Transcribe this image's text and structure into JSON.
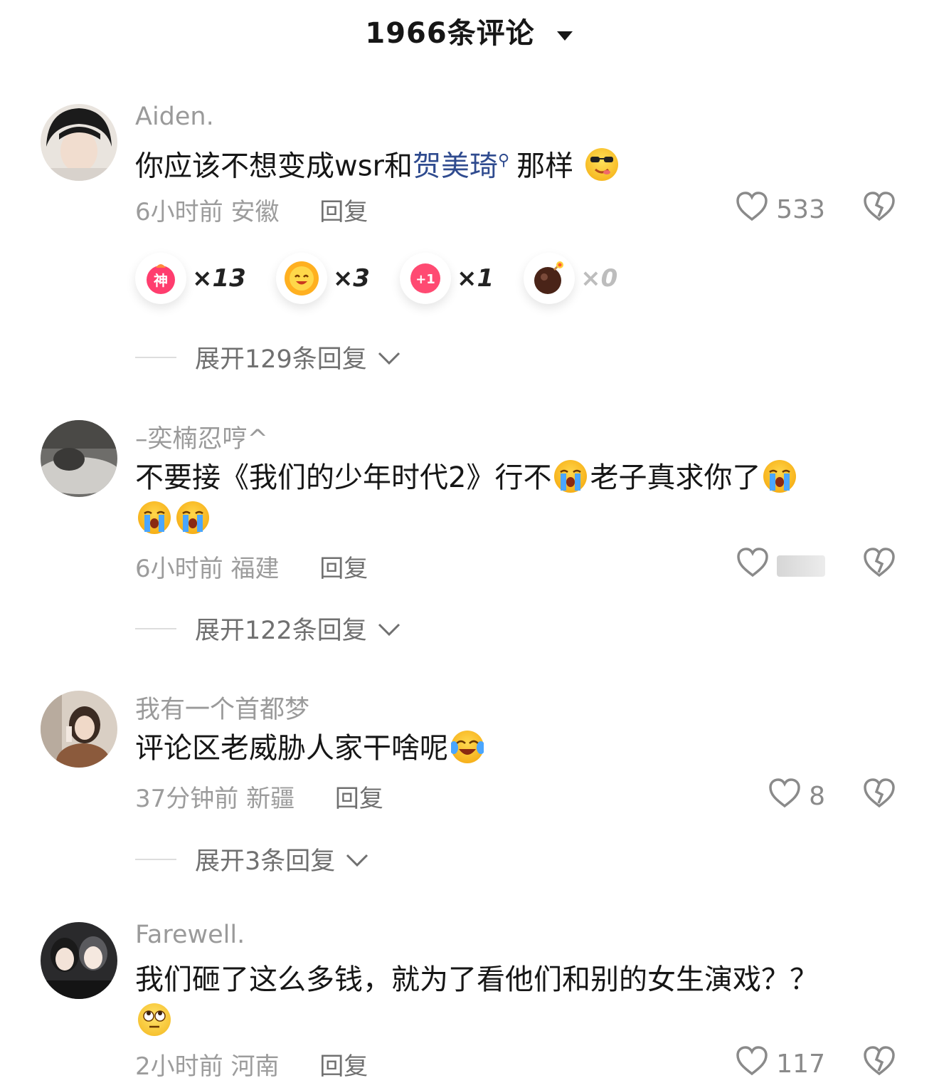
{
  "header": {
    "title": "1966条评论"
  },
  "comments": [
    {
      "username": "Aiden.",
      "text_pre": "你应该不想变成wsr和",
      "link": "贺美琦",
      "text_post": "那样",
      "time": "6小时前",
      "location": "安徽",
      "reply": "回复",
      "likes": "533",
      "reactions": [
        {
          "icon": "shen-badge-icon",
          "count": "×13"
        },
        {
          "icon": "sun-smile-icon",
          "count": "×3"
        },
        {
          "icon": "plus-one-icon",
          "count": "×1"
        },
        {
          "icon": "bomb-icon",
          "count": "×0"
        }
      ],
      "expand": "展开129条回复"
    },
    {
      "username": "–奕楠忍哼^",
      "text_a": "不要接《我们的少年时代2》行不",
      "text_b": "老子真求你了",
      "time": "6小时前",
      "location": "福建",
      "reply": "回复",
      "likes": "",
      "expand": "展开122条回复"
    },
    {
      "username": "我有一个首都梦",
      "text": "评论区老威胁人家干啥呢",
      "time": "37分钟前",
      "location": "新疆",
      "reply": "回复",
      "likes": "8",
      "expand": "展开3条回复"
    },
    {
      "username": "Farewell.",
      "text": "我们砸了这么多钱，就为了看他们和别的女生演戏？？",
      "time": "2小时前",
      "location": "河南",
      "reply": "回复",
      "likes": "117"
    }
  ],
  "colors": {
    "link": "#2f4b8f",
    "muted": "#9c9c9c",
    "text": "#161616"
  }
}
